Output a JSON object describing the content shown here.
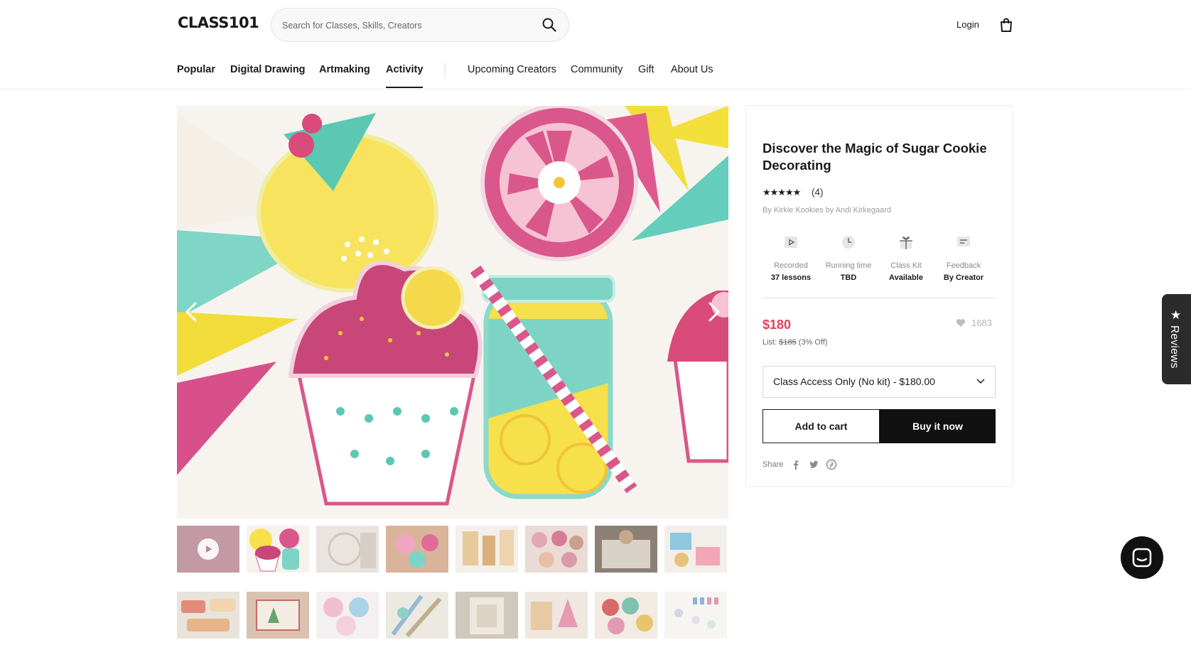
{
  "header": {
    "logo": "CLASS101",
    "search_placeholder": "Search for Classes, Skills, Creators",
    "login": "Login"
  },
  "nav": {
    "primary": [
      "Popular",
      "Digital Drawing",
      "Artmaking",
      "Activity"
    ],
    "active": "Activity",
    "secondary": [
      "Upcoming Creators",
      "Community",
      "Gift",
      "About Us"
    ]
  },
  "product": {
    "title": "Discover the Magic of Sugar Cookie Decorating",
    "rating_stars": "★★★★★",
    "rating_count": "(4)",
    "byline": "By Kirkie Kookies by Andi Kirkegaard",
    "features": [
      {
        "icon": "play-icon",
        "label": "Recorded",
        "value": "37 lessons"
      },
      {
        "icon": "clock-icon",
        "label": "Running time",
        "value": "TBD"
      },
      {
        "icon": "gift-icon",
        "label": "Class Kit",
        "value": "Available"
      },
      {
        "icon": "chat-bubble-icon",
        "label": "Feedback",
        "value": "By Creator"
      }
    ],
    "price": "$180",
    "list_label": "List:",
    "list_price": "$185",
    "discount": "(3% Off)",
    "likes": "1683",
    "option_selected": "Class Access Only (No kit) - $180.00",
    "add_to_cart": "Add to cart",
    "buy_now": "Buy it now",
    "share_label": "Share",
    "share_icons": [
      "facebook-icon",
      "twitter-icon",
      "pinterest-icon"
    ]
  },
  "gallery": {
    "thumbnail_count": 16
  },
  "side_tab": {
    "label": "Reviews"
  },
  "colors": {
    "price": "#e2405a",
    "primary_button": "#111111"
  }
}
